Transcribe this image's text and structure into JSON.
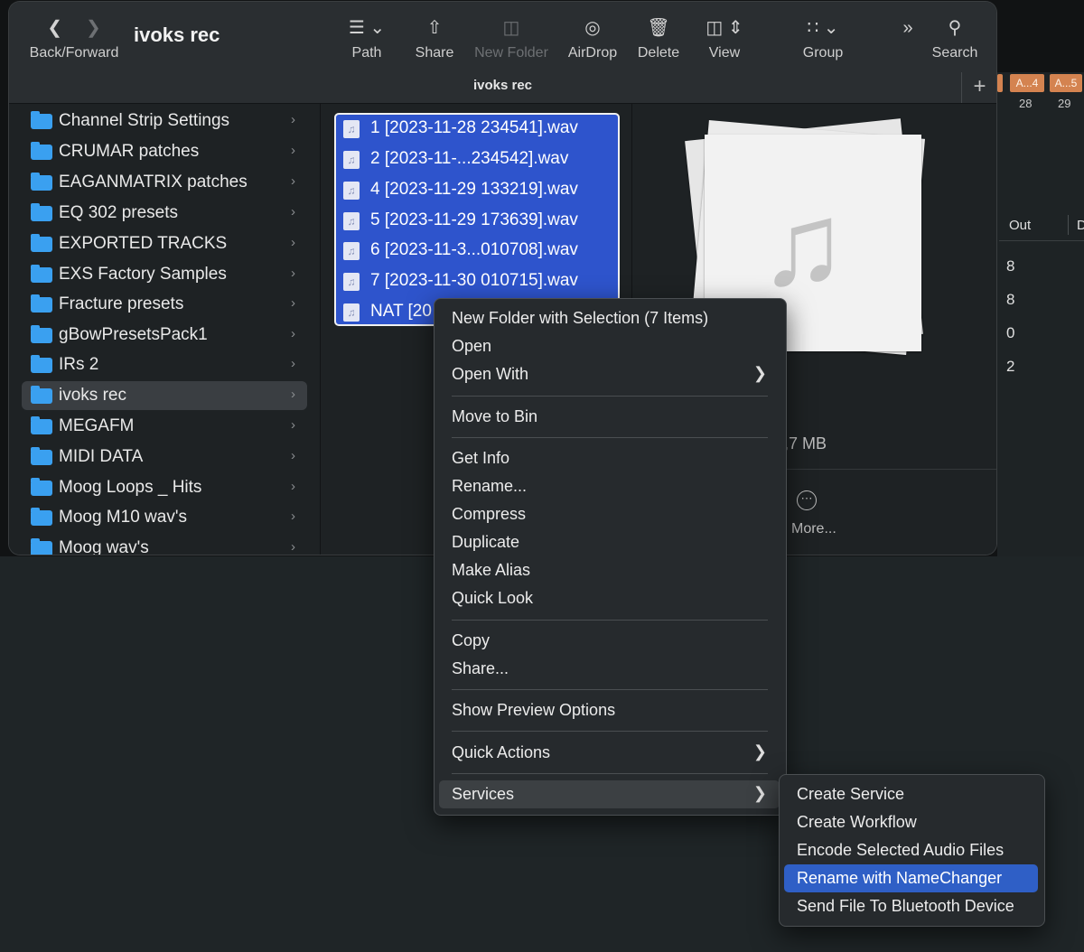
{
  "window": {
    "title": "ivoks rec",
    "path_title": "ivoks rec"
  },
  "toolbar": {
    "back_forward_label": "Back/Forward",
    "path_label": "Path",
    "share_label": "Share",
    "new_folder_label": "New Folder",
    "airdrop_label": "AirDrop",
    "delete_label": "Delete",
    "view_label": "View",
    "group_label": "Group",
    "search_label": "Search"
  },
  "sidebar": {
    "folders": [
      {
        "name": "Channel Strip Settings"
      },
      {
        "name": "CRUMAR patches"
      },
      {
        "name": "EAGANMATRIX patches"
      },
      {
        "name": "EQ 302 presets"
      },
      {
        "name": "EXPORTED TRACKS"
      },
      {
        "name": "EXS Factory Samples"
      },
      {
        "name": "Fracture presets"
      },
      {
        "name": "gBowPresetsPack1"
      },
      {
        "name": "IRs  2"
      },
      {
        "name": "ivoks rec",
        "selected": true
      },
      {
        "name": "MEGAFM"
      },
      {
        "name": "MIDI DATA"
      },
      {
        "name": "Moog Loops _ Hits"
      },
      {
        "name": "Moog M10 wav's"
      },
      {
        "name": "Moog wav's"
      }
    ]
  },
  "files": [
    {
      "name": "1 [2023-11-28 234541].wav"
    },
    {
      "name": "2 [2023-11-...234542].wav"
    },
    {
      "name": "4 [2023-11-29 133219].wav"
    },
    {
      "name": "5 [2023-11-29 173639].wav"
    },
    {
      "name": "6 [2023-11-3...010708].wav"
    },
    {
      "name": "7 [2023-11-30 010715].wav"
    },
    {
      "name": "NAT [20"
    }
  ],
  "preview": {
    "size_text": "6,7 MB",
    "more_label": "More..."
  },
  "context_menu": {
    "items": [
      {
        "label": "New Folder with Selection (7 Items)"
      },
      {
        "label": "Open"
      },
      {
        "label": "Open With",
        "submenu": true
      },
      {
        "label": "Move to Bin"
      },
      {
        "label": "Get Info"
      },
      {
        "label": "Rename..."
      },
      {
        "label": "Compress"
      },
      {
        "label": "Duplicate"
      },
      {
        "label": "Make Alias"
      },
      {
        "label": "Quick Look"
      },
      {
        "label": "Copy"
      },
      {
        "label": "Share..."
      },
      {
        "label": "Show Preview Options"
      },
      {
        "label": "Quick Actions",
        "submenu": true
      },
      {
        "label": "Services",
        "submenu": true,
        "hover": true
      }
    ]
  },
  "services_menu": {
    "items": [
      {
        "label": "Create Service"
      },
      {
        "label": "Create Workflow"
      },
      {
        "label": "Encode Selected Audio Files"
      },
      {
        "label": "Rename with NameChanger",
        "highlighted": true
      },
      {
        "label": "Send File To Bluetooth Device"
      }
    ]
  },
  "daw_background": {
    "regions": [
      "A...4",
      "A...5"
    ],
    "bar_numbers": [
      "28",
      "29"
    ],
    "column_headers": [
      "Out",
      "D"
    ],
    "values": [
      "8",
      "8",
      "0",
      "2"
    ]
  },
  "colors": {
    "folder_blue": "#3aa0f0",
    "selection_blue": "#2e54cc",
    "highlight_blue": "#2f5fc6",
    "daw_region_orange": "#d48350"
  }
}
